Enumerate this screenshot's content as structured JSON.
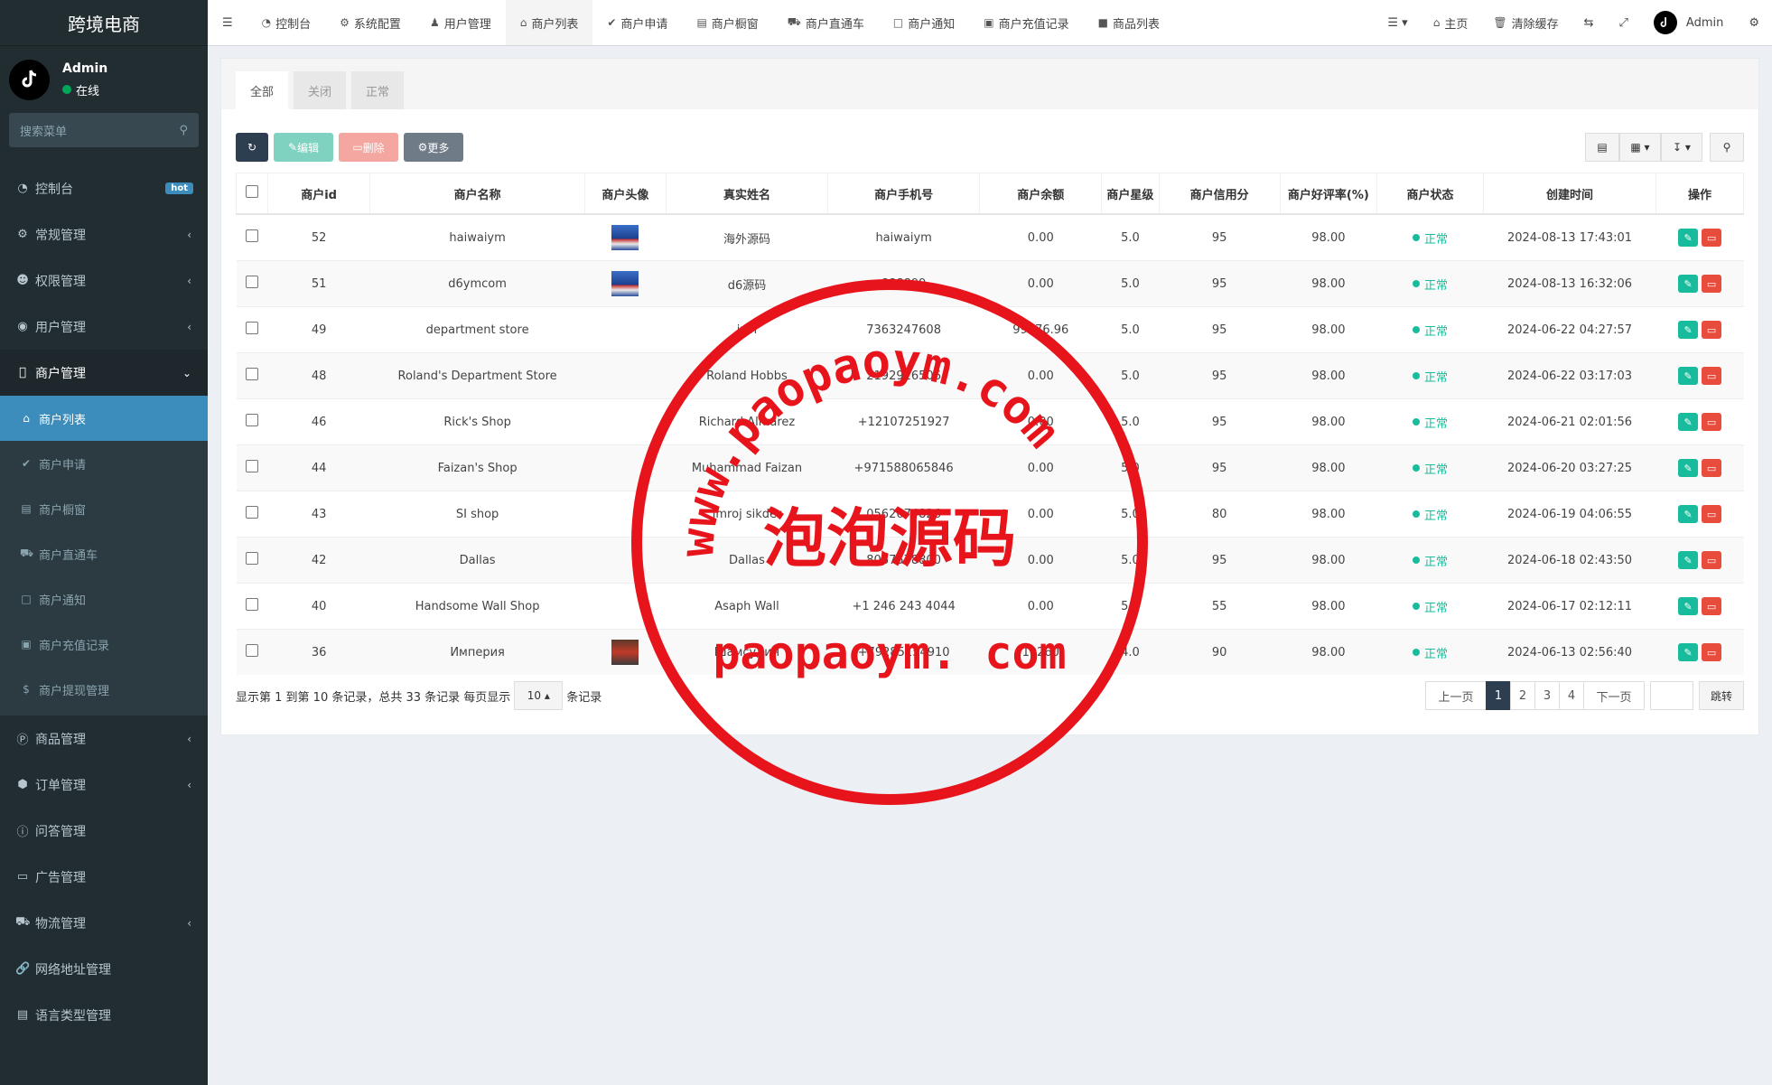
{
  "brand": "跨境电商",
  "user": {
    "name": "Admin",
    "status": "在线"
  },
  "sidebar": {
    "search_placeholder": "搜索菜单",
    "items": [
      {
        "label": "控制台",
        "icon": "dashboard-icon",
        "badge": "hot"
      },
      {
        "label": "常规管理",
        "icon": "cogs-icon"
      },
      {
        "label": "权限管理",
        "icon": "group-icon"
      },
      {
        "label": "用户管理",
        "icon": "user-circle-icon"
      },
      {
        "label": "商户管理",
        "icon": "apple-icon"
      }
    ],
    "merchant_sub": [
      {
        "label": "商户列表",
        "icon": "home-icon"
      },
      {
        "label": "商户申请",
        "icon": "check-circle-icon"
      },
      {
        "label": "商户橱窗",
        "icon": "shop-icon"
      },
      {
        "label": "商户直通车",
        "icon": "car-icon"
      },
      {
        "label": "商户通知",
        "icon": "notice-icon"
      },
      {
        "label": "商户充值记录",
        "icon": "money-icon"
      },
      {
        "label": "商户提现管理",
        "icon": "dollar-icon"
      }
    ],
    "items_after": [
      {
        "label": "商品管理",
        "icon": "product-icon"
      },
      {
        "label": "订单管理",
        "icon": "cube-icon"
      },
      {
        "label": "问答管理",
        "icon": "question-icon"
      },
      {
        "label": "广告管理",
        "icon": "ad-icon"
      },
      {
        "label": "物流管理",
        "icon": "truck-icon"
      },
      {
        "label": "网络地址管理",
        "icon": "link-icon"
      },
      {
        "label": "语言类型管理",
        "icon": "language-icon"
      }
    ]
  },
  "topnav": {
    "tabs": [
      "控制台",
      "系统配置",
      "用户管理",
      "商户列表",
      "商户申请",
      "商户橱窗",
      "商户直通车",
      "商户通知",
      "商户充值记录",
      "商品列表"
    ],
    "right": {
      "home": "主页",
      "clear_cache": "清除缓存",
      "admin": "Admin"
    }
  },
  "panel": {
    "tabs": [
      "全部",
      "关闭",
      "正常"
    ],
    "toolbar": {
      "edit": "编辑",
      "delete": "删除",
      "more": "更多"
    }
  },
  "table": {
    "headers": [
      "商户id",
      "商户名称",
      "商户头像",
      "真实姓名",
      "商户手机号",
      "商户余额",
      "商户星级",
      "商户信用分",
      "商户好评率(%)",
      "商户状态",
      "创建时间",
      "操作"
    ],
    "rows": [
      {
        "id": "52",
        "name": "haiwaiym",
        "avatar": "blue",
        "real": "海外源码",
        "phone": "haiwaiym",
        "balance": "0.00",
        "star": "5.0",
        "credit": "95",
        "rate": "98.00",
        "status": "正常",
        "created": "2024-08-13 17:43:01"
      },
      {
        "id": "51",
        "name": "d6ymcom",
        "avatar": "blue",
        "real": "d6源码",
        "phone": "888899",
        "balance": "0.00",
        "star": "5.0",
        "credit": "95",
        "rate": "98.00",
        "status": "正常",
        "created": "2024-08-13 16:32:06"
      },
      {
        "id": "49",
        "name": "department store",
        "avatar": "",
        "real": "jzin",
        "phone": "7363247608",
        "balance": "99776.96",
        "star": "5.0",
        "credit": "95",
        "rate": "98.00",
        "status": "正常",
        "created": "2024-06-22 04:27:57"
      },
      {
        "id": "48",
        "name": "Roland's Department Store",
        "avatar": "",
        "real": "Roland Hobbs",
        "phone": "2192926506",
        "balance": "0.00",
        "star": "5.0",
        "credit": "95",
        "rate": "98.00",
        "status": "正常",
        "created": "2024-06-22 03:17:03"
      },
      {
        "id": "46",
        "name": "Rick's Shop",
        "avatar": "",
        "real": "Richard Almarez",
        "phone": "+12107251927",
        "balance": "0.00",
        "star": "5.0",
        "credit": "95",
        "rate": "98.00",
        "status": "正常",
        "created": "2024-06-21 02:01:56"
      },
      {
        "id": "44",
        "name": "Faizan's Shop",
        "avatar": "",
        "real": "Muhammad Faizan",
        "phone": "+971588065846",
        "balance": "0.00",
        "star": "5.0",
        "credit": "95",
        "rate": "98.00",
        "status": "正常",
        "created": "2024-06-20 03:27:25"
      },
      {
        "id": "43",
        "name": "SI shop",
        "avatar": "",
        "real": "Imroj sikder",
        "phone": "0562674826",
        "balance": "0.00",
        "star": "5.0",
        "credit": "80",
        "rate": "98.00",
        "status": "正常",
        "created": "2024-06-19 04:06:55"
      },
      {
        "id": "42",
        "name": "Dallas",
        "avatar": "",
        "real": "Dallas",
        "phone": "8067578800",
        "balance": "0.00",
        "star": "5.0",
        "credit": "95",
        "rate": "98.00",
        "status": "正常",
        "created": "2024-06-18 02:43:50"
      },
      {
        "id": "40",
        "name": "Handsome Wall Shop",
        "avatar": "",
        "real": "Asaph Wall",
        "phone": "+1 246 243 4044",
        "balance": "0.00",
        "star": "5.0",
        "credit": "55",
        "rate": "98.00",
        "status": "正常",
        "created": "2024-06-17 02:12:11"
      },
      {
        "id": "36",
        "name": "Империя",
        "avatar": "car",
        "real": "Шамсудин",
        "phone": "+79285154910",
        "balance": "19260",
        "star": "4.0",
        "credit": "90",
        "rate": "98.00",
        "status": "正常",
        "created": "2024-06-13 02:56:40"
      }
    ]
  },
  "footer": {
    "info_pre": "显示第 1 到第 10 条记录，总共 33 条记录 每页显示",
    "page_size": "10",
    "info_post": "条记录",
    "prev": "上一页",
    "pages": [
      "1",
      "2",
      "3",
      "4"
    ],
    "next": "下一页",
    "jump": "跳转"
  },
  "watermark": {
    "top": "www.paopaoym.com",
    "middle": "泡泡源码",
    "bottom": "paopaoym. com"
  },
  "colors": {
    "sidebar": "#222d32",
    "active": "#3c8dbc",
    "ok": "#18bc9c",
    "danger": "#e74c3c",
    "stamp": "#e8141c"
  }
}
